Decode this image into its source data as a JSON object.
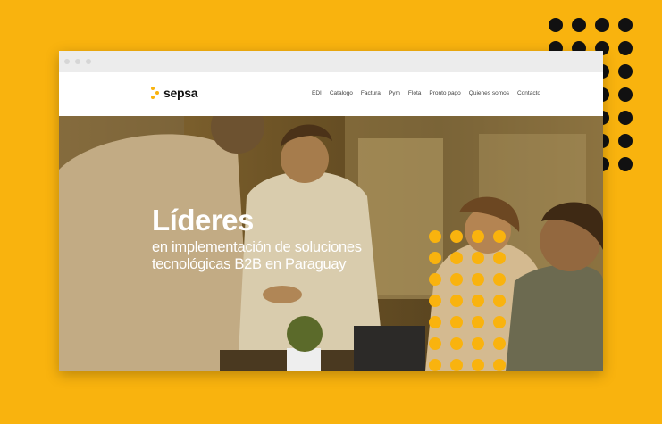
{
  "brand": {
    "name": "sepsa",
    "accent": "#F9B30E",
    "background": "#F9B30E",
    "dot_color": "#111111"
  },
  "nav": {
    "items": [
      {
        "label": "EDI"
      },
      {
        "label": "Catalogo"
      },
      {
        "label": "Factura"
      },
      {
        "label": "Pym"
      },
      {
        "label": "Flota"
      },
      {
        "label": "Pronto pago"
      },
      {
        "label": "Quienes somos"
      },
      {
        "label": "Contacto"
      }
    ]
  },
  "hero": {
    "title": "Líderes",
    "subtitle_line1": "en implementación de soluciones",
    "subtitle_line2": "tecnológicas B2B en Paraguay"
  }
}
